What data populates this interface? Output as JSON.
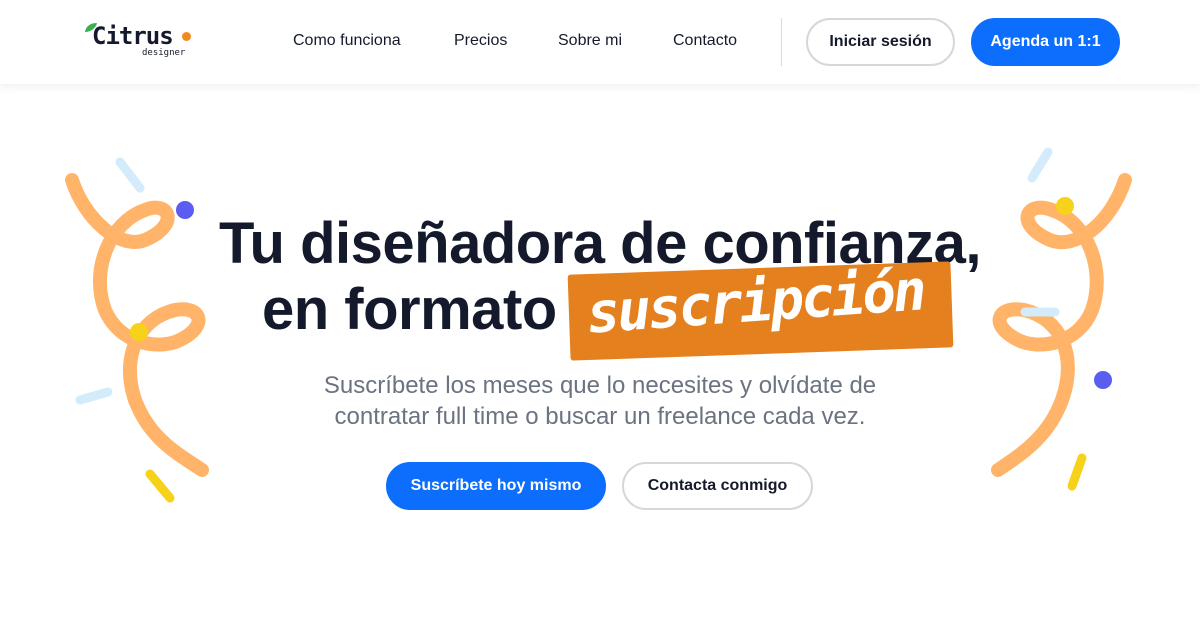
{
  "brand": {
    "name": "Citrus",
    "tagline": "designer",
    "colors": {
      "leaf": "#37b24d",
      "orange": "#f08a1c"
    }
  },
  "nav": {
    "items": [
      {
        "label": "Como funciona"
      },
      {
        "label": "Precios"
      },
      {
        "label": "Sobre mi"
      },
      {
        "label": "Contacto"
      }
    ],
    "login_label": "Iniciar sesión",
    "cta_label": "Agenda un 1:1"
  },
  "hero": {
    "title_line1": "Tu diseñadora de confianza,",
    "title_line2": "en formato",
    "title_highlight": "suscripción",
    "subtitle_line1": "Suscríbete los meses que lo necesites y olvídate de",
    "subtitle_line2": "contratar full time o buscar un freelance cada vez.",
    "primary_cta": "Suscríbete hoy mismo",
    "secondary_cta": "Contacta conmigo"
  },
  "colors": {
    "primary": "#0d6efd",
    "text": "#141a2b",
    "muted": "#6b7280",
    "highlight": "#e5801e",
    "confetti_orange": "#ffb469",
    "confetti_blue": "#d4ebfb",
    "confetti_purple": "#5b5cf0",
    "confetti_yellow": "#f7d21a"
  },
  "icons": [
    "leaf-icon",
    "orange-dot-icon",
    "confetti-decoration"
  ]
}
